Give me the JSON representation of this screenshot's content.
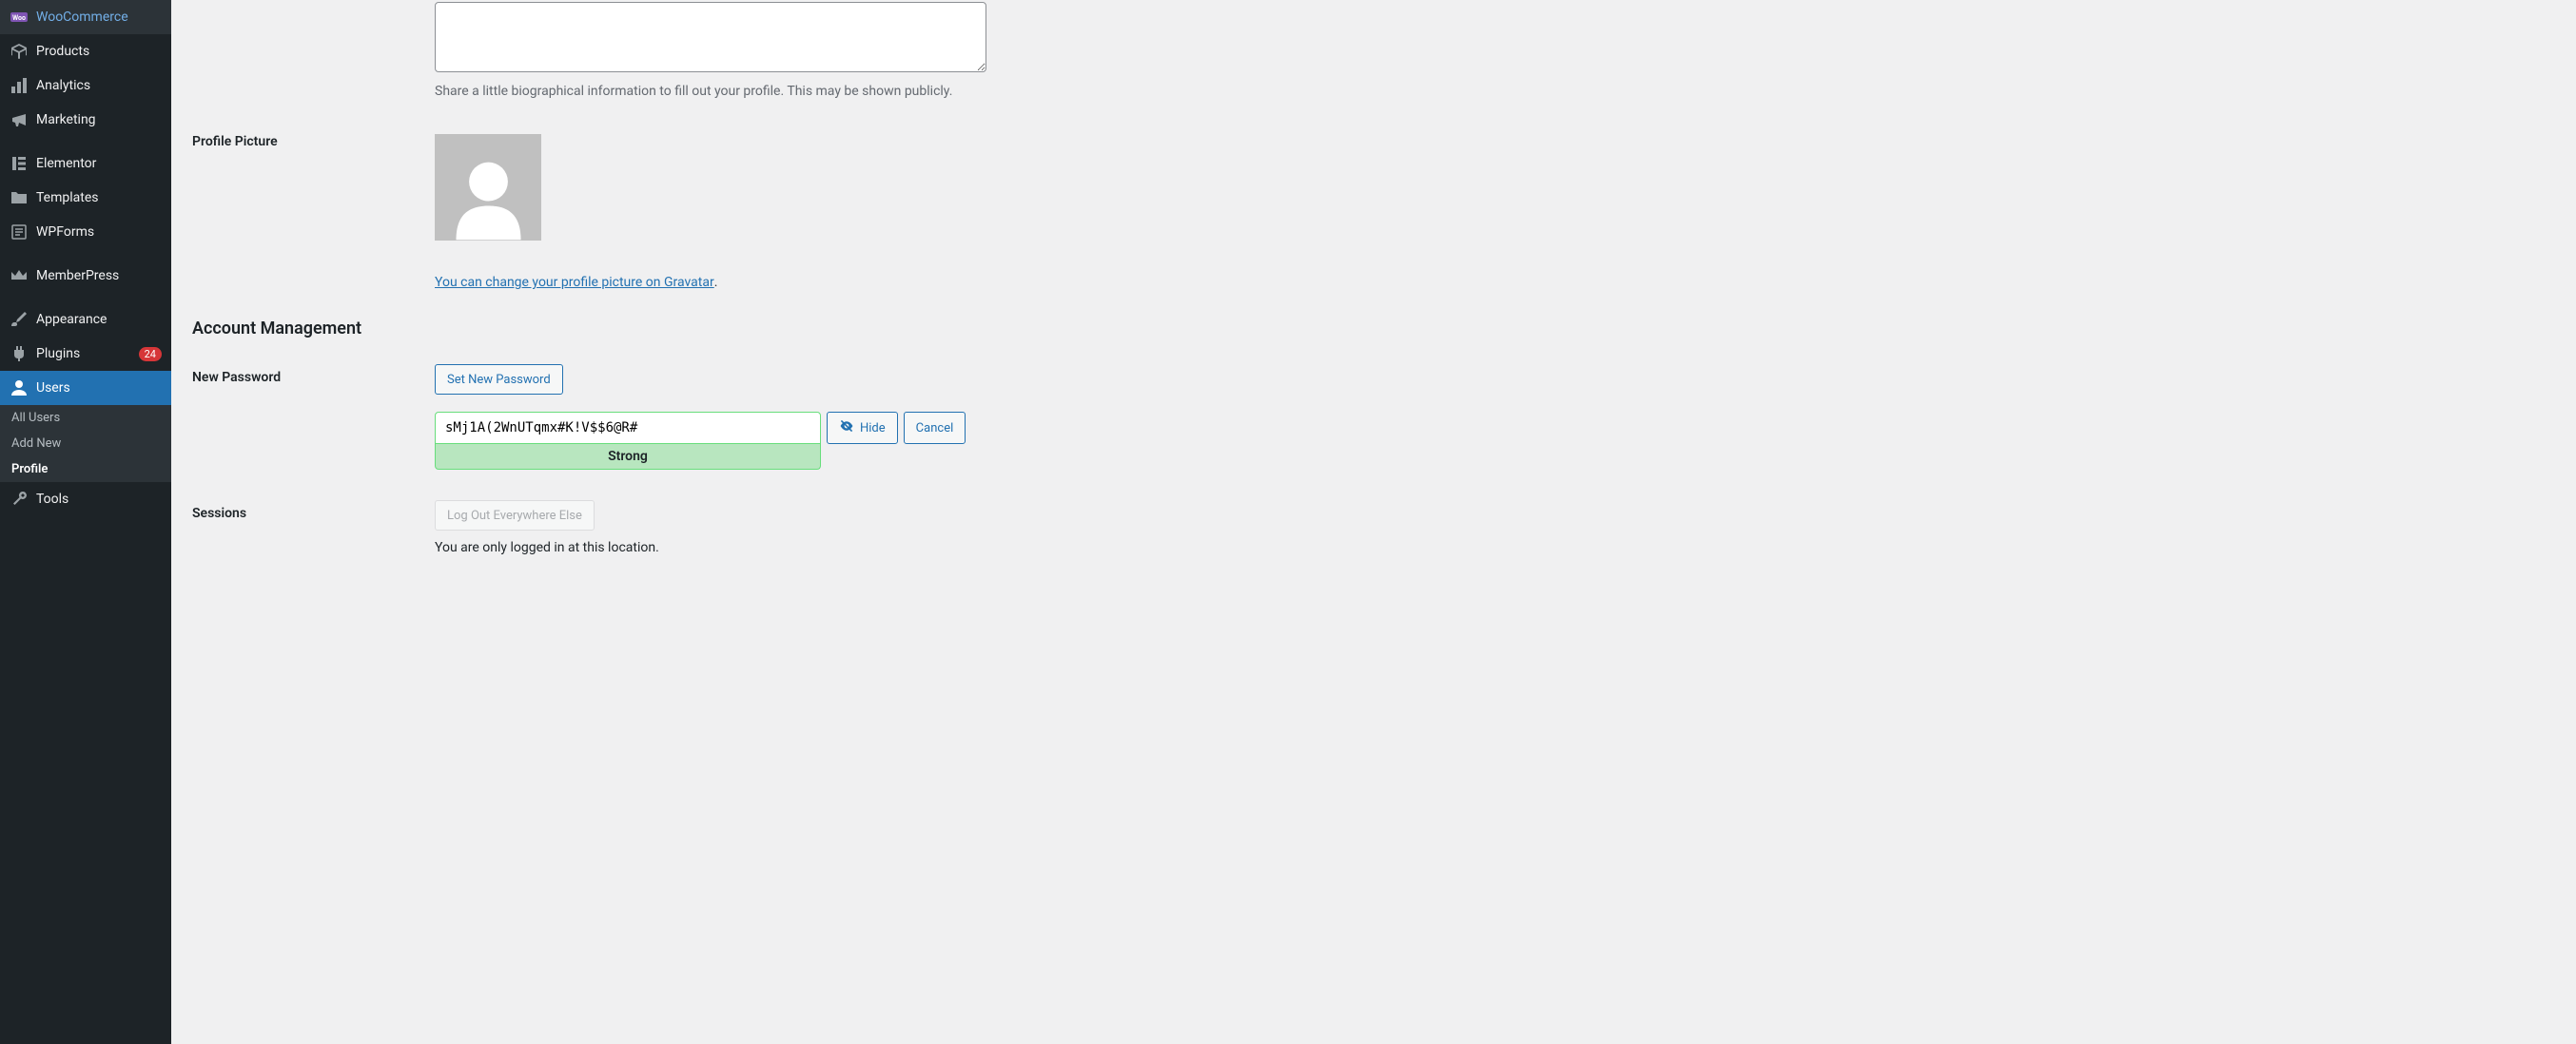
{
  "sidebar": {
    "items": [
      {
        "label": "WooCommerce"
      },
      {
        "label": "Products"
      },
      {
        "label": "Analytics"
      },
      {
        "label": "Marketing"
      },
      {
        "label": "Elementor"
      },
      {
        "label": "Templates"
      },
      {
        "label": "WPForms"
      },
      {
        "label": "MemberPress"
      },
      {
        "label": "Appearance"
      },
      {
        "label": "Plugins",
        "badge": "24"
      },
      {
        "label": "Users",
        "active": true
      },
      {
        "label": "Tools"
      }
    ],
    "submenu": [
      {
        "label": "All Users"
      },
      {
        "label": "Add New"
      },
      {
        "label": "Profile",
        "current": true
      }
    ]
  },
  "bio": {
    "description": "Share a little biographical information to fill out your profile. This may be shown publicly."
  },
  "profile_picture": {
    "label": "Profile Picture",
    "gravatar_link": "You can change your profile picture on Gravatar",
    "period": "."
  },
  "account_management": {
    "heading": "Account Management"
  },
  "new_password": {
    "label": "New Password",
    "set_button": "Set New Password",
    "value": "sMj1A(2WnUTqmx#K!V$$6@R#",
    "strength": "Strong",
    "hide_button": "Hide",
    "cancel_button": "Cancel"
  },
  "sessions": {
    "label": "Sessions",
    "logout_button": "Log Out Everywhere Else",
    "description": "You are only logged in at this location."
  }
}
